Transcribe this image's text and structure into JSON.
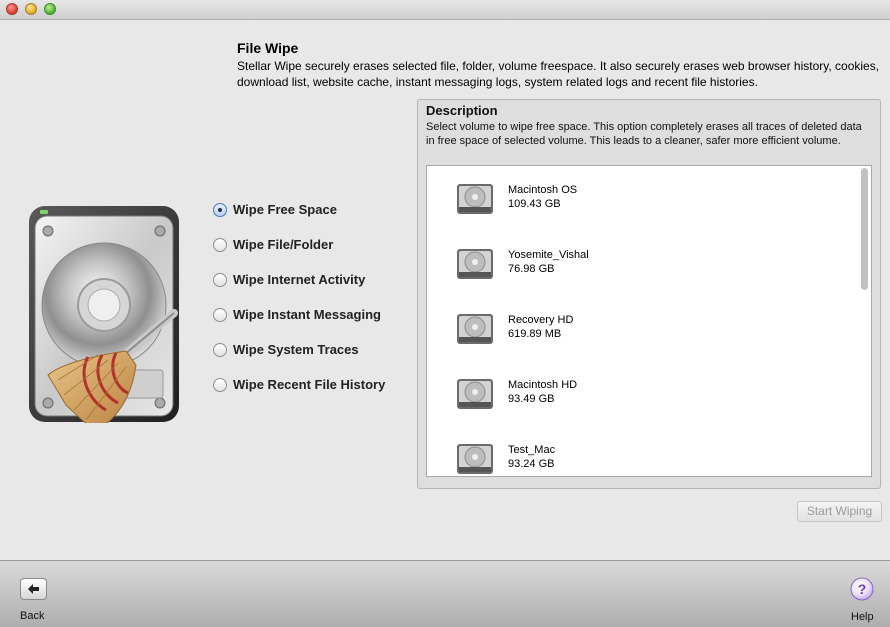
{
  "window": {
    "controls": [
      "close",
      "minimize",
      "maximize"
    ]
  },
  "header": {
    "title": "File Wipe",
    "description": "Stellar Wipe securely erases selected file, folder, volume freespace. It also securely erases web browser history, cookies, download list, website cache, instant messaging logs, system related logs and recent file histories."
  },
  "options": [
    {
      "label": "Wipe Free Space",
      "selected": true
    },
    {
      "label": "Wipe File/Folder",
      "selected": false
    },
    {
      "label": "Wipe Internet Activity",
      "selected": false
    },
    {
      "label": "Wipe Instant Messaging",
      "selected": false
    },
    {
      "label": "Wipe System Traces",
      "selected": false
    },
    {
      "label": "Wipe Recent File History",
      "selected": false
    }
  ],
  "description_panel": {
    "title": "Description",
    "text": "Select volume to wipe free space. This option completely erases all traces of deleted data in free space of selected volume. This leads to a cleaner, safer more efficient volume."
  },
  "volumes": [
    {
      "name": "Macintosh OS",
      "size": "109.43 GB",
      "icon": "hard-drive-icon"
    },
    {
      "name": "Yosemite_Vishal",
      "size": "76.98 GB",
      "icon": "hard-drive-icon"
    },
    {
      "name": "Recovery HD",
      "size": "619.89 MB",
      "icon": "hard-drive-icon"
    },
    {
      "name": "Macintosh HD",
      "size": "93.49 GB",
      "icon": "hard-drive-icon"
    },
    {
      "name": "Test_Mac",
      "size": "93.24 GB",
      "icon": "hard-drive-icon"
    }
  ],
  "actions": {
    "start_label": "Start Wiping",
    "start_enabled": false
  },
  "footer": {
    "back_label": "Back",
    "help_label": "Help"
  },
  "colors": {
    "background": "#e8e8e8",
    "radio_selected": "#4a78b8",
    "help_icon": "#8a63c8"
  }
}
